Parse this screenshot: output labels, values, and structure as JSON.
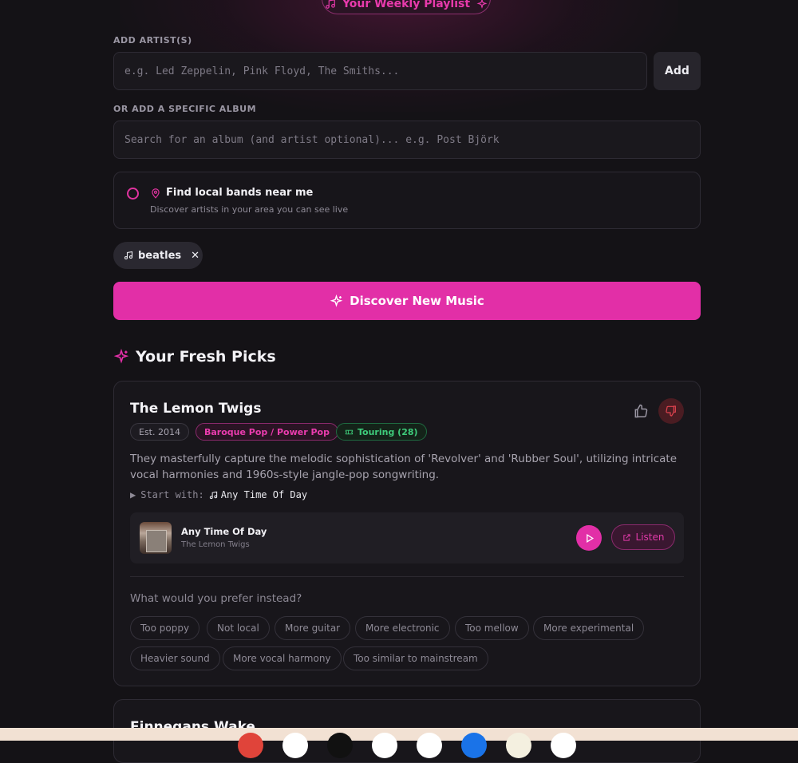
{
  "header": {
    "weekly_playlist": "Your Weekly Playlist"
  },
  "artists": {
    "label": "ADD ARTIST(S)",
    "placeholder": "e.g. Led Zeppelin, Pink Floyd, The Smiths...",
    "add_label": "Add"
  },
  "album": {
    "label": "OR ADD A SPECIFIC ALBUM",
    "placeholder": "Search for an album (and artist optional)... e.g. Post Björk"
  },
  "local": {
    "title": "Find local bands near me",
    "subtitle": "Discover artists in your area you can see live"
  },
  "selected_tags": [
    {
      "label": "beatles"
    }
  ],
  "discover_label": "Discover New Music",
  "picks": {
    "title": "Your Fresh Picks",
    "cards": [
      {
        "name": "The Lemon Twigs",
        "established": "Est. 2014",
        "genre": "Baroque Pop / Power Pop",
        "touring": "Touring (28)",
        "description": "They masterfully capture the melodic sophistication of 'Revolver' and 'Rubber Soul', utilizing intricate vocal harmonies and 1960s-style jangle-pop songwriting.",
        "start_with_label": "Start with:",
        "start_with_song": "Any Time Of Day",
        "track": {
          "title": "Any Time Of Day",
          "artist": "The Lemon Twigs",
          "listen_label": "Listen"
        },
        "prefer_question": "What would you prefer instead?",
        "preferences": [
          "Too poppy",
          "Not local",
          "More guitar",
          "More electronic",
          "Too mellow",
          "More experimental",
          "Heavier sound",
          "More vocal harmony",
          "Too similar to mainstream"
        ]
      },
      {
        "name": "Finnegans Wake"
      }
    ]
  },
  "colors": {
    "accent": "#e22fa7",
    "background": "#141216",
    "touring": "#3ecb7a",
    "dislike": "#e0434f"
  }
}
